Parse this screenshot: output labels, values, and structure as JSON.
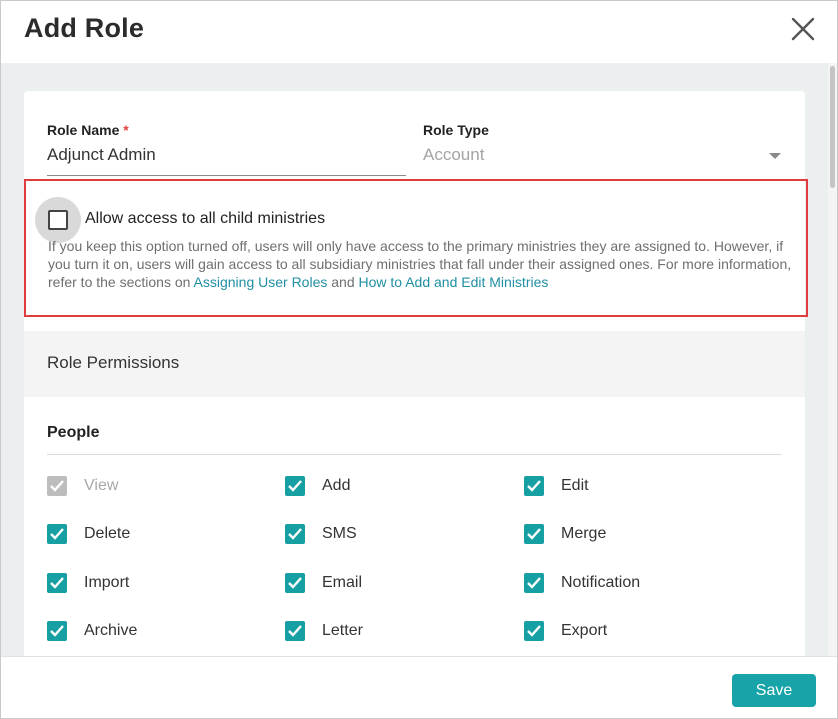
{
  "dialog": {
    "title": "Add Role",
    "close_icon": "close-icon"
  },
  "form": {
    "role_name": {
      "label": "Role Name",
      "required_mark": "*",
      "value": "Adjunct Admin"
    },
    "role_type": {
      "label": "Role Type",
      "value": "Account",
      "icon": "chevron-down-icon"
    }
  },
  "child_access": {
    "label": "Allow access to all child ministries",
    "checked": false,
    "description_prefix": "If you keep this option turned off, users will only have access to the primary ministries they are assigned to. However, if you turn it on, users will gain access to all subsidiary ministries that fall under their assigned ones. For more information, refer to the sections on ",
    "link1": "Assigning User Roles",
    "and_text": " and ",
    "link2": "How to Add and Edit Ministries"
  },
  "permissions": {
    "heading": "Role Permissions",
    "group": "People",
    "items": [
      {
        "label": "View",
        "checked": true,
        "disabled": true
      },
      {
        "label": "Add",
        "checked": true,
        "disabled": false
      },
      {
        "label": "Edit",
        "checked": true,
        "disabled": false
      },
      {
        "label": "Delete",
        "checked": true,
        "disabled": false
      },
      {
        "label": "SMS",
        "checked": true,
        "disabled": false
      },
      {
        "label": "Merge",
        "checked": true,
        "disabled": false
      },
      {
        "label": "Import",
        "checked": true,
        "disabled": false
      },
      {
        "label": "Email",
        "checked": true,
        "disabled": false
      },
      {
        "label": "Notification",
        "checked": true,
        "disabled": false
      },
      {
        "label": "Archive",
        "checked": true,
        "disabled": false
      },
      {
        "label": "Letter",
        "checked": true,
        "disabled": false
      },
      {
        "label": "Export",
        "checked": true,
        "disabled": false
      }
    ]
  },
  "footer": {
    "save_label": "Save"
  },
  "colors": {
    "accent": "#17a3a8",
    "highlight_border": "#e03c3c",
    "required": "#e0443a"
  }
}
